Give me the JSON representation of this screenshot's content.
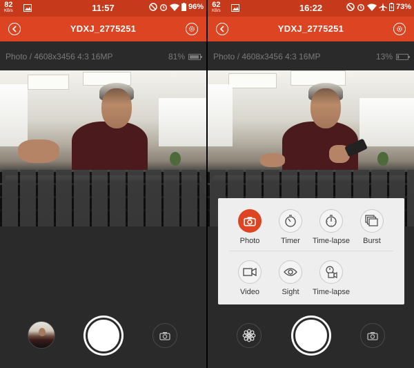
{
  "left": {
    "status": {
      "speed": "82",
      "speed_unit": "KB/s",
      "time": "11:57",
      "battery": "96%"
    },
    "app_title": "YDXJ_2775251",
    "info": {
      "mode": "Photo / 4608x3456 4:3 16MP",
      "battery": "81%",
      "battery_level": 0.81
    }
  },
  "right": {
    "status": {
      "speed": "62",
      "speed_unit": "KB/s",
      "time": "16:22",
      "battery": "73%"
    },
    "app_title": "YDXJ_2775251",
    "info": {
      "mode": "Photo / 4608x3456 4:3 16MP",
      "battery": "13%",
      "battery_level": 0.13
    },
    "menu": {
      "items": [
        {
          "label": "Photo",
          "icon": "camera-icon",
          "active": true
        },
        {
          "label": "Timer",
          "icon": "timer-icon",
          "active": false
        },
        {
          "label": "Time-lapse",
          "icon": "stopwatch-icon",
          "active": false
        },
        {
          "label": "Burst",
          "icon": "burst-icon",
          "active": false
        },
        {
          "label": "Video",
          "icon": "video-icon",
          "active": false
        },
        {
          "label": "Sight",
          "icon": "eye-icon",
          "active": false
        },
        {
          "label": "Time-lapse",
          "icon": "video-timelapse-icon",
          "active": false
        }
      ]
    }
  },
  "colors": {
    "status_bar": "#c6391b",
    "app_bar": "#dd4421",
    "accent": "#dd4421",
    "background": "#2a2a2a"
  }
}
